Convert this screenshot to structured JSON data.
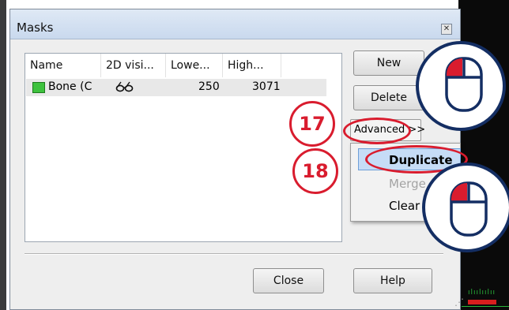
{
  "dialog": {
    "title": "Masks",
    "close_glyph": "✕"
  },
  "list": {
    "columns": [
      "Name",
      "2D visi...",
      "Lowe...",
      "High..."
    ],
    "rows": [
      {
        "name": "Bone (C",
        "visibility_icon": "glasses-icon",
        "lower": "250",
        "upper": "3071"
      }
    ]
  },
  "buttons": {
    "new": "New",
    "delete": "Delete",
    "advanced": "Advanced >>",
    "close": "Close",
    "help": "Help"
  },
  "menu": {
    "items": [
      "Duplicate",
      "Merge",
      "Clear"
    ]
  },
  "callouts": {
    "step_a": "17",
    "step_b": "18"
  },
  "colors": {
    "accent_red": "#d91c2e",
    "mouse_navy": "#142e63",
    "mask_green": "#3ec23e",
    "menu_highlight": "#c6dcf6"
  }
}
